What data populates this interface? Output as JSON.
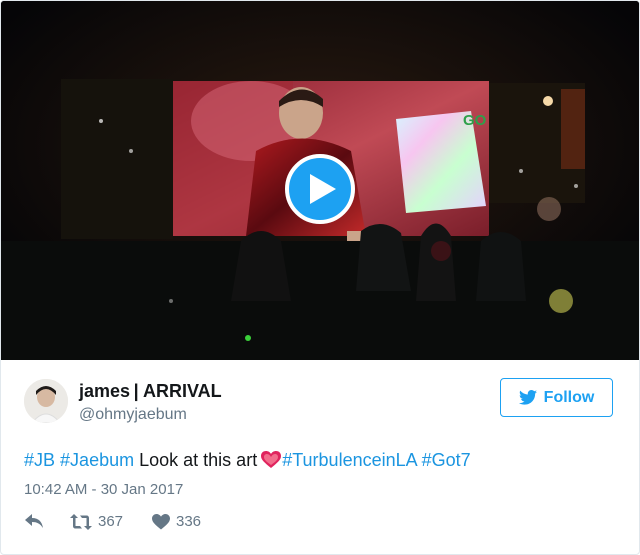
{
  "tweet": {
    "author_name": "james | ARRIVAL",
    "handle": "@ohmyjaebum",
    "follow_label": "Follow",
    "text_parts": {
      "tag1": "#JB",
      "tag2": "#Jaebum",
      "plain": "Look at this art",
      "tag3": "#TurbulenceinLA",
      "tag4": "#Got7"
    },
    "timestamp": "10:42 AM - 30 Jan 2017",
    "retweet_count": "367",
    "like_count": "336"
  },
  "video": {
    "screen_sign_text": "GO"
  },
  "colors": {
    "brand": "#1da1f2",
    "link": "#1b95e0",
    "secondary_text": "#657786",
    "heart_emoji": "#e0245e"
  },
  "icons": [
    "play-icon",
    "twitter-bird-icon",
    "heart-emoji-icon",
    "reply-icon",
    "retweet-icon",
    "like-icon"
  ]
}
